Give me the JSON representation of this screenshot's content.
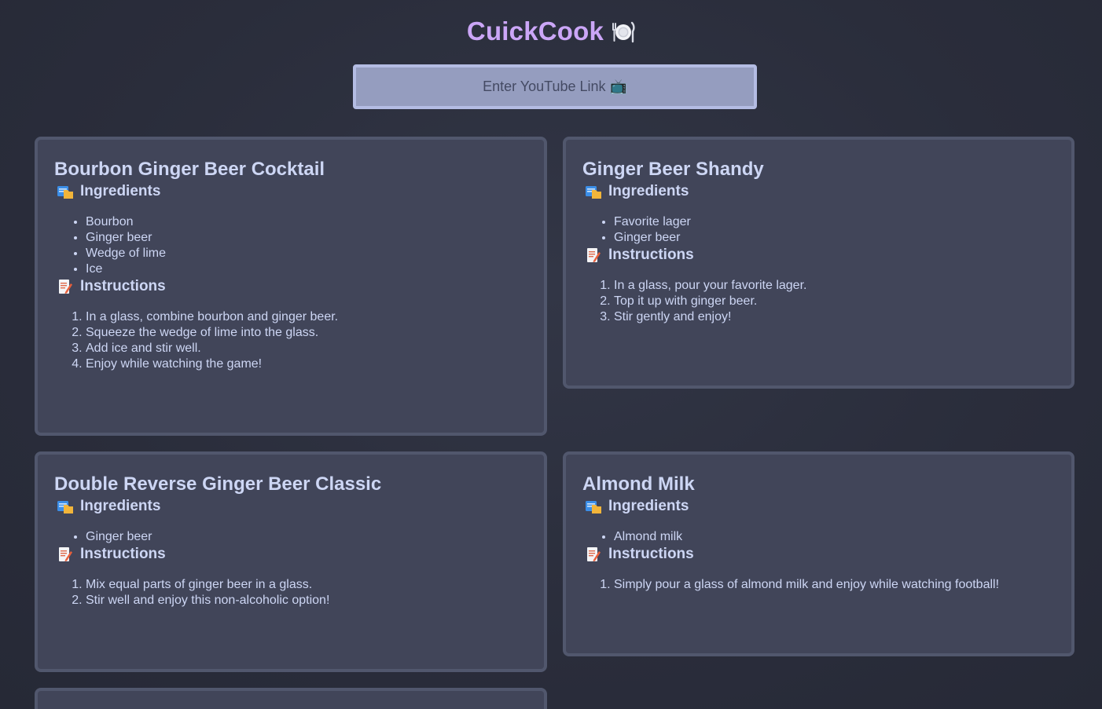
{
  "header": {
    "title": "CuickCook",
    "emoji": "🍽️"
  },
  "search": {
    "placeholder": "Enter YouTube Link 📺"
  },
  "sections": {
    "ingredients_label": "Ingredients",
    "instructions_label": "Instructions",
    "ingredients_icon": "clipboard-folder-icon",
    "instructions_icon": "memo-icon"
  },
  "recipes": [
    {
      "title": "Bourbon Ginger Beer Cocktail",
      "ingredients": [
        "Bourbon",
        "Ginger beer",
        "Wedge of lime",
        "Ice"
      ],
      "instructions": [
        "In a glass, combine bourbon and ginger beer.",
        "Squeeze the wedge of lime into the glass.",
        "Add ice and stir well.",
        "Enjoy while watching the game!"
      ]
    },
    {
      "title": "Ginger Beer Shandy",
      "ingredients": [
        "Favorite lager",
        "Ginger beer"
      ],
      "instructions": [
        "In a glass, pour your favorite lager.",
        "Top it up with ginger beer.",
        "Stir gently and enjoy!"
      ]
    },
    {
      "title": "Double Reverse Ginger Beer Classic",
      "ingredients": [
        "Ginger beer"
      ],
      "instructions": [
        "Mix equal parts of ginger beer in a glass.",
        "Stir well and enjoy this non-alcoholic option!"
      ]
    },
    {
      "title": "Almond Milk",
      "ingredients": [
        "Almond milk"
      ],
      "instructions": [
        "Simply pour a glass of almond milk and enjoy while watching football!"
      ]
    },
    {
      "title": "",
      "ingredients": [],
      "instructions": []
    }
  ],
  "colors": {
    "background": "#2a2d3b",
    "card": "#414559",
    "card_border": "#51576d",
    "accent_title": "#cba6f7",
    "text": "#cdd6f4",
    "input_bg": "#959dbf",
    "input_border": "#b4bce3"
  }
}
